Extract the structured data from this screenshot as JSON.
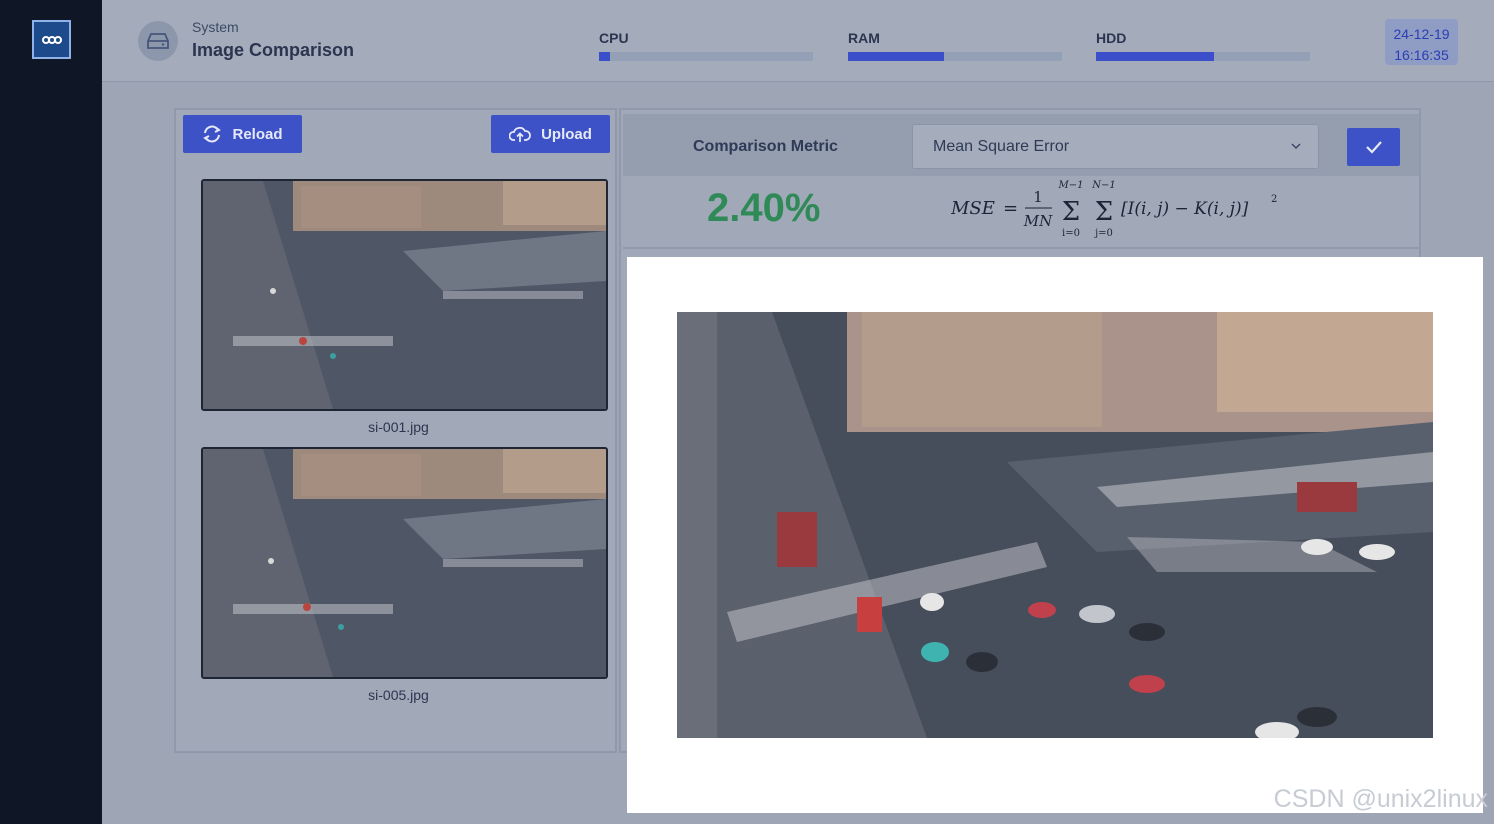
{
  "header": {
    "breadcrumb": "System",
    "title": "Image Comparison",
    "meters": [
      {
        "label": "CPU",
        "percent": 5
      },
      {
        "label": "RAM",
        "percent": 45
      },
      {
        "label": "HDD",
        "percent": 55
      }
    ],
    "date": "24-12-19",
    "time": "16:16:35"
  },
  "left_panel": {
    "reload_label": "Reload",
    "upload_label": "Upload",
    "images": [
      {
        "filename": "si-001.jpg"
      },
      {
        "filename": "si-005.jpg"
      }
    ]
  },
  "right_panel": {
    "metric_label": "Comparison Metric",
    "metric_selected": "Mean Square Error",
    "score": "2.40%",
    "formula": {
      "lhs": "MSE",
      "frac_num": "1",
      "frac_den": "MN",
      "sum1_upper": "M−1",
      "sum1_lower": "i=0",
      "sum2_upper": "N−1",
      "sum2_lower": "j=0",
      "body": "[I(i, j) − K(i, j)]",
      "exponent": "2"
    }
  },
  "watermark": "CSDN @unix2linux",
  "colors": {
    "accent": "#3d52c6",
    "score_green": "#2f8a57",
    "sidebar": "#0f1726"
  }
}
